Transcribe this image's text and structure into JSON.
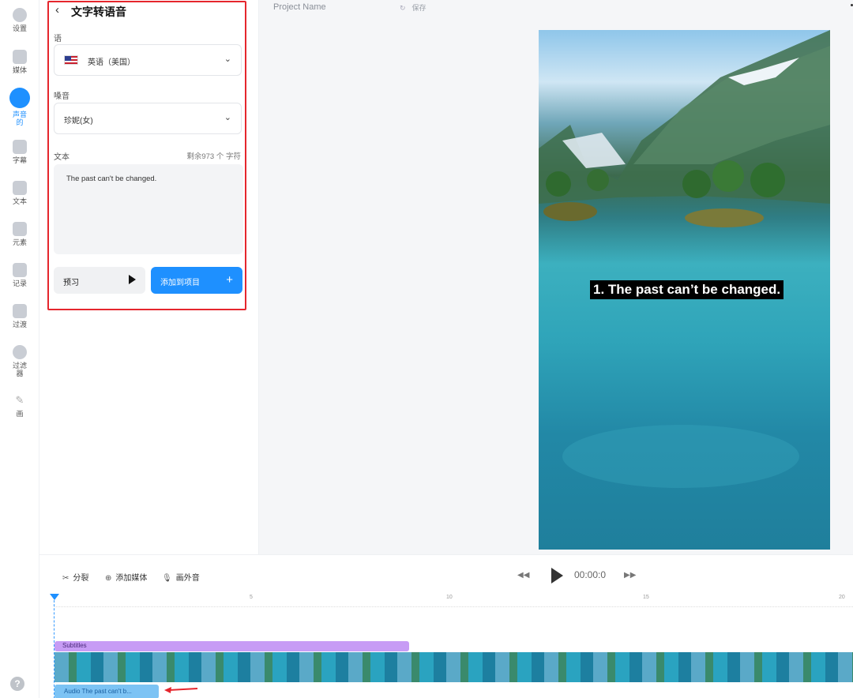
{
  "rail": {
    "items": [
      {
        "label": "设置",
        "icon": "settings-icon"
      },
      {
        "label": "媒体",
        "icon": "media-icon"
      },
      {
        "label": "声音的",
        "icon": "music-note-icon"
      },
      {
        "label": "字幕",
        "icon": "subtitles-icon"
      },
      {
        "label": "文本",
        "icon": "text-icon"
      },
      {
        "label": "元素",
        "icon": "elements-icon"
      },
      {
        "label": "记录",
        "icon": "record-icon"
      },
      {
        "label": "过渡",
        "icon": "transitions-icon"
      },
      {
        "label": "过滤器",
        "icon": "filters-icon"
      },
      {
        "label": "画",
        "icon": "draw-icon"
      }
    ],
    "help_label": "?"
  },
  "panel": {
    "title": "文字转语音",
    "language_label": "语",
    "language_value": "英语（美国）",
    "voice_label": "嗓音",
    "voice_value": "珍妮(女)",
    "text_label": "文本",
    "counter": "剩余973 个 字符",
    "text_value": "The past can't be changed.",
    "preview_label": "预习",
    "add_label": "添加到项目",
    "add_plus": "+"
  },
  "topbar": {
    "project_name": "Project Name",
    "save_label": "保存"
  },
  "preview": {
    "subtitle": "1. The past can’t be changed."
  },
  "timeline": {
    "split_label": "分裂",
    "add_media_label": "添加媒体",
    "voiceover_label": "画外音",
    "time": "00:00:0",
    "ticks": [
      "5",
      "10",
      "15",
      "20"
    ],
    "subtitles_track_label": "Subtitles",
    "audio_track_label": "Audio The past can't b..."
  },
  "colors": {
    "accent": "#1e90ff",
    "highlight_box": "#e5262d",
    "subtitle_track": "#c79cf5",
    "audio_track": "#7cc3f4"
  }
}
